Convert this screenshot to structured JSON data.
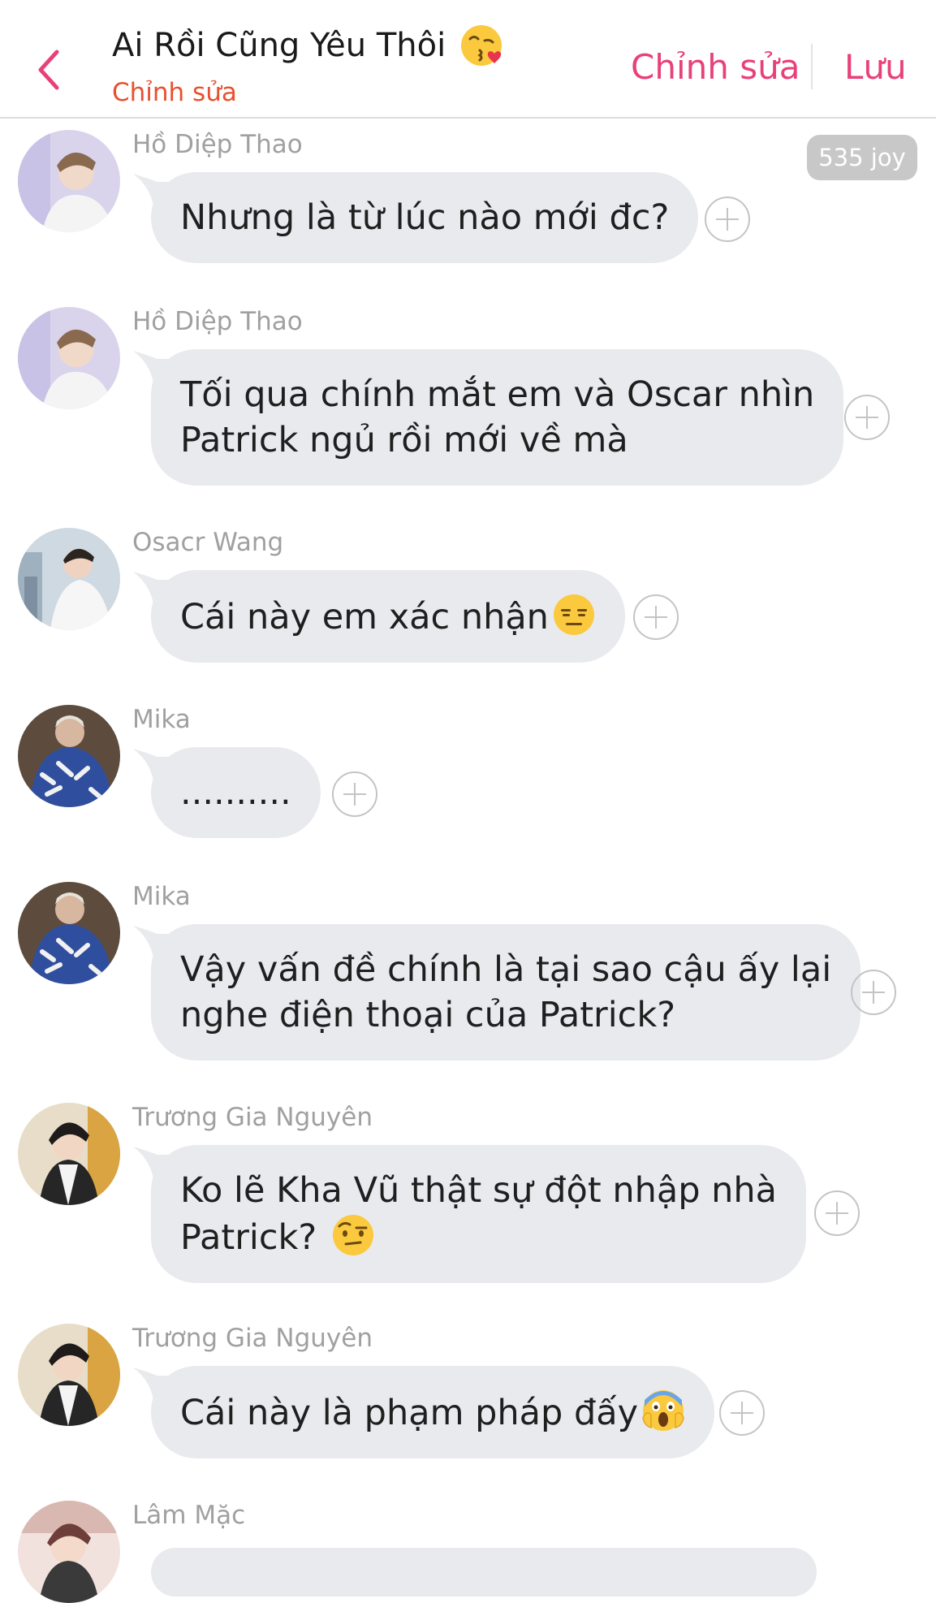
{
  "header": {
    "title": "Ai Rồi Cũng Yêu Thôi",
    "title_emoji_icon": "face-blowing-kiss-icon",
    "subtitle": "Chỉnh sửa",
    "edit_label": "Chỉnh sửa",
    "save_label": "Lưu",
    "back_icon": "chevron-left-icon",
    "accent_color": "#e8417a",
    "subtitle_color": "#e8502e"
  },
  "badge": {
    "label": "535 joy"
  },
  "messages": [
    {
      "sender": "Hồ Diệp Thao",
      "line1": "Nhưng là từ lúc nào mới đc?",
      "line2": ""
    },
    {
      "sender": "Hồ Diệp Thao",
      "line1": "Tối qua chính mắt em và Oscar nhìn",
      "line2": "Patrick ngủ rồi mới về mà"
    },
    {
      "sender": "Osacr Wang",
      "line1": "Cái này em xác nhận",
      "line2": "",
      "emoji_icon": "expressionless-face-icon"
    },
    {
      "sender": "Mika",
      "line1": "..........",
      "line2": ""
    },
    {
      "sender": "Mika",
      "line1": "Vậy vấn đề chính là tại sao cậu ấy lại",
      "line2": "nghe điện thoại của Patrick?"
    },
    {
      "sender": "Trương Gia Nguyên",
      "line1": "Ko lẽ Kha Vũ thật sự đột nhập nhà",
      "line2": "Patrick? ",
      "emoji_icon": "raised-eyebrow-face-icon"
    },
    {
      "sender": "Trương Gia Nguyên",
      "line1": "Cái này là phạm pháp đấy",
      "line2": "",
      "emoji_icon": "screaming-face-icon"
    },
    {
      "sender": "Lâm Mặc",
      "line1": "",
      "line2": ""
    }
  ],
  "colors": {
    "bubble": "#e9eaee",
    "sender_text": "#a0a0a0",
    "message_text": "#1f1f1f"
  }
}
